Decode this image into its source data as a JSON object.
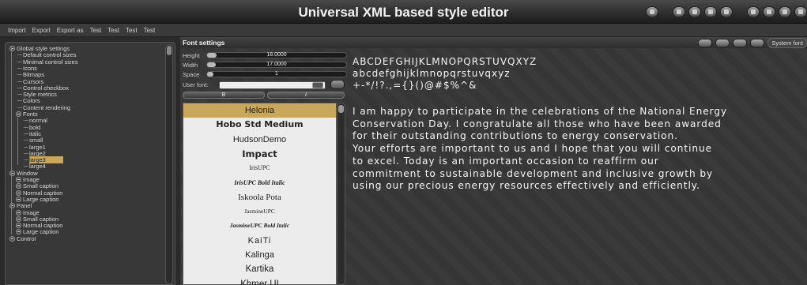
{
  "window": {
    "title": "Universal XML based style editor"
  },
  "menu": [
    "Import",
    "Export",
    "Export as",
    "Test",
    "Test",
    "Test",
    "Test"
  ],
  "tree": {
    "items": [
      {
        "label": "Global style settings",
        "level": 0,
        "expander": true
      },
      {
        "label": "Default control sizes",
        "level": 1
      },
      {
        "label": "Minimal control sizes",
        "level": 1
      },
      {
        "label": "Icons",
        "level": 1
      },
      {
        "label": "Bitmaps",
        "level": 1
      },
      {
        "label": "Cursors",
        "level": 1
      },
      {
        "label": "Control checkbox",
        "level": 1
      },
      {
        "label": "Style metrics",
        "level": 1
      },
      {
        "label": "Colors",
        "level": 1
      },
      {
        "label": "Content rendering",
        "level": 1
      },
      {
        "label": "Fonts",
        "level": 1,
        "expander": true
      },
      {
        "label": "normal",
        "level": 2
      },
      {
        "label": "bold",
        "level": 2
      },
      {
        "label": "italic",
        "level": 2
      },
      {
        "label": "small",
        "level": 2
      },
      {
        "label": "large1",
        "level": 2
      },
      {
        "label": "large2",
        "level": 2
      },
      {
        "label": "large3",
        "level": 2,
        "selected": true
      },
      {
        "label": "large4",
        "level": 2
      },
      {
        "label": "Window",
        "level": 0,
        "expander": true
      },
      {
        "label": "Image",
        "level": 1,
        "expander": true
      },
      {
        "label": "Small caption",
        "level": 1,
        "expander": true
      },
      {
        "label": "Normal caption",
        "level": 1,
        "expander": true
      },
      {
        "label": "Large caption",
        "level": 1,
        "expander": true
      },
      {
        "label": "Panel",
        "level": 0,
        "expander": true
      },
      {
        "label": "Image",
        "level": 1,
        "expander": true
      },
      {
        "label": "Small caption",
        "level": 1,
        "expander": true
      },
      {
        "label": "Normal caption",
        "level": 1,
        "expander": true
      },
      {
        "label": "Large caption",
        "level": 1,
        "expander": true
      },
      {
        "label": "Control",
        "level": 0,
        "expander": true
      }
    ]
  },
  "font_settings": {
    "title": "Font settings",
    "system_font_label": "System font",
    "height_label": "Height",
    "height_value": "18.0000",
    "width_label": "Width",
    "width_value": "17.0000",
    "space_label": "Space",
    "space_value": "1",
    "user_font_label": "User font:",
    "bold_button": "B",
    "italic_button": "I"
  },
  "font_list": [
    {
      "name": "Helonia",
      "selected": true
    },
    {
      "name": "Hobo Std Medium"
    },
    {
      "name": "HudsonDemo"
    },
    {
      "name": "Impact"
    },
    {
      "name": "IrisUPC"
    },
    {
      "name": "IrisUPC Bold Italic"
    },
    {
      "name": "Iskoola Pota"
    },
    {
      "name": "JasmineUPC"
    },
    {
      "name": "JasmineUPC Bold Italic"
    },
    {
      "name": "KaiTi"
    },
    {
      "name": "Kalinga"
    },
    {
      "name": "Kartika"
    },
    {
      "name": "Khmer UI"
    }
  ],
  "preview": {
    "upper": "ABCDEFGHIJKLMNOPQRSTUVQXYZ",
    "lower": "abcdefghijklmnopqrstuvqxyz",
    "symbols": "+-*/!?.,={}()@#$%^&",
    "lines": [
      "I am happy to participate in the celebrations of the National Energy",
      "Conservation Day. I congratulate all those who have been awarded",
      "for their outstanding contributions to energy conservation.",
      "Your efforts are important to us and I hope that you will continue",
      "to excel. Today is an important occasion to reaffirm our",
      "commitment to sustainable development and inclusive growth by",
      "using our precious energy resources effectively and efficiently."
    ]
  },
  "colors": {
    "selection": "#c9a85a"
  }
}
